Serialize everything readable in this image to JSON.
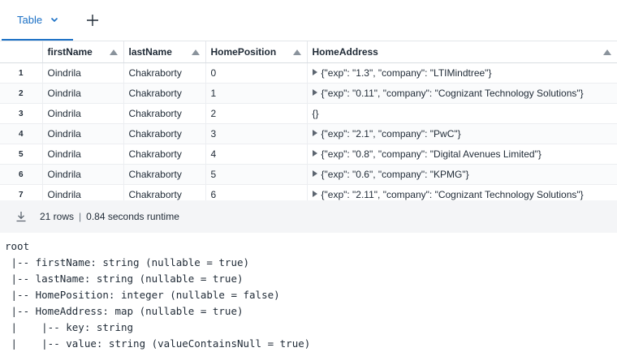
{
  "tabs": {
    "active_label": "Table"
  },
  "table": {
    "columns": [
      "firstName",
      "lastName",
      "HomePosition",
      "HomeAddress"
    ],
    "rows": [
      {
        "index": "1",
        "firstName": "Oindrila",
        "lastName": "Chakraborty",
        "HomePosition": "0",
        "HomeAddress": "{\"exp\": \"1.3\", \"company\": \"LTIMindtree\"}",
        "expandable": true
      },
      {
        "index": "2",
        "firstName": "Oindrila",
        "lastName": "Chakraborty",
        "HomePosition": "1",
        "HomeAddress": "{\"exp\": \"0.11\", \"company\": \"Cognizant Technology Solutions\"}",
        "expandable": true
      },
      {
        "index": "3",
        "firstName": "Oindrila",
        "lastName": "Chakraborty",
        "HomePosition": "2",
        "HomeAddress": "{}",
        "expandable": false
      },
      {
        "index": "4",
        "firstName": "Oindrila",
        "lastName": "Chakraborty",
        "HomePosition": "3",
        "HomeAddress": "{\"exp\": \"2.1\", \"company\": \"PwC\"}",
        "expandable": true
      },
      {
        "index": "5",
        "firstName": "Oindrila",
        "lastName": "Chakraborty",
        "HomePosition": "4",
        "HomeAddress": "{\"exp\": \"0.8\", \"company\": \"Digital Avenues Limited\"}",
        "expandable": true
      },
      {
        "index": "6",
        "firstName": "Oindrila",
        "lastName": "Chakraborty",
        "HomePosition": "5",
        "HomeAddress": "{\"exp\": \"0.6\", \"company\": \"KPMG\"}",
        "expandable": true
      },
      {
        "index": "7",
        "firstName": "Oindrila",
        "lastName": "Chakraborty",
        "HomePosition": "6",
        "HomeAddress": "{\"exp\": \"2.11\", \"company\": \"Cognizant Technology Solutions\"}",
        "expandable": true
      }
    ]
  },
  "status": {
    "rows": "21 rows",
    "separator": "|",
    "runtime": "0.84 seconds runtime"
  },
  "schema": {
    "lines": [
      "root",
      " |-- firstName: string (nullable = true)",
      " |-- lastName: string (nullable = true)",
      " |-- HomePosition: integer (nullable = false)",
      " |-- HomeAddress: map (nullable = true)",
      " |    |-- key: string",
      " |    |-- value: string (valueContainsNull = true)"
    ]
  },
  "colors": {
    "accent": "#1b70c5",
    "status_bg": "#f4f5f7"
  }
}
